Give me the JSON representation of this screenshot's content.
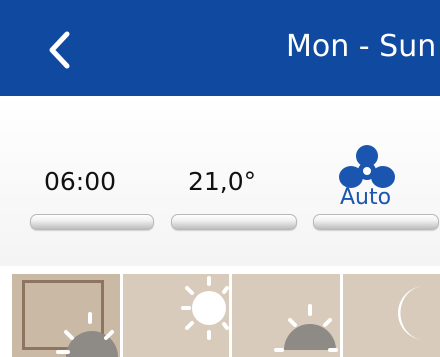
{
  "header": {
    "title": "Mon - Sun",
    "back_icon": "chevron-left-icon",
    "background_color": "#0f4aa0"
  },
  "settings": {
    "time": "06:00",
    "temperature": "21,0°",
    "fan": {
      "icon": "fan-icon",
      "label": "Auto",
      "color": "#1a55b0"
    }
  },
  "periods": [
    {
      "icon": "sunrise-icon",
      "selected": true
    },
    {
      "icon": "sun-icon",
      "selected": false
    },
    {
      "icon": "sunset-icon",
      "selected": false
    },
    {
      "icon": "moon-icon",
      "selected": false
    }
  ]
}
